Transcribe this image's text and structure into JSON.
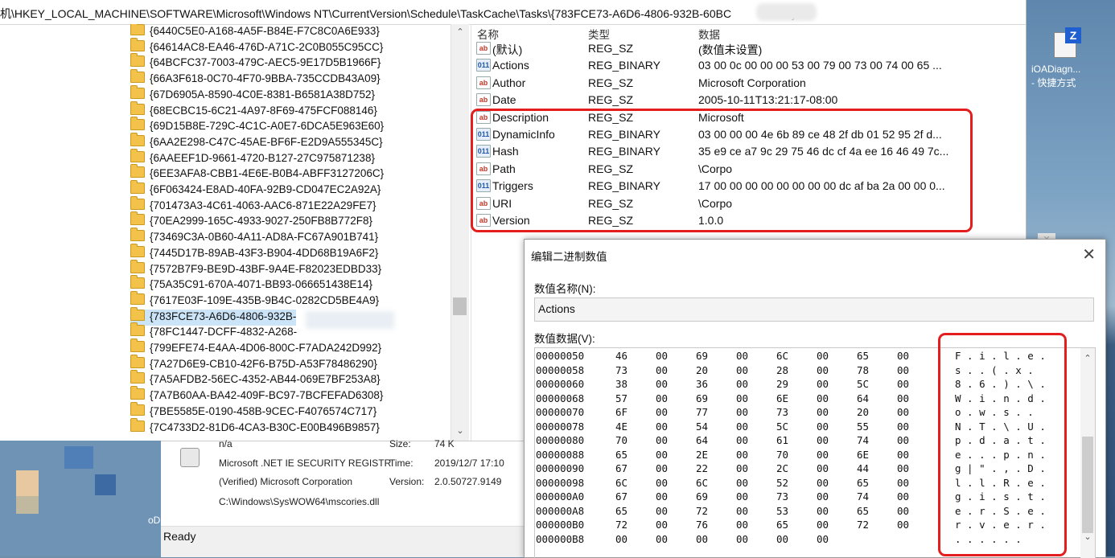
{
  "address_bar": {
    "path": "机\\HKEY_LOCAL_MACHINE\\SOFTWARE\\Microsoft\\Windows NT\\CurrentVersion\\Schedule\\TaskCache\\Tasks\\{783FCE73-A6D6-4806-932B-60BC",
    "path_end": "}"
  },
  "tree": {
    "items": [
      "{6440C5E0-A168-4A5F-B84E-F7C8C0A6E933}",
      "{64614AC8-EA46-476D-A71C-2C0B055C95CC}",
      "{64BCFC37-7003-479C-AEC5-9E17D5B1966F}",
      "{66A3F618-0C70-4F70-9BBA-735CCDB43A09}",
      "{67D6905A-8590-4C0E-8381-B6581A38D752}",
      "{68ECBC15-6C21-4A97-8F69-475FCF088146}",
      "{69D15B8E-729C-4C1C-A0E7-6DCA5E963E60}",
      "{6AA2E298-C47C-45AE-BF6F-E2D9A555345C}",
      "{6AAEEF1D-9661-4720-B127-27C975871238}",
      "{6EE3AFA8-CBB1-4E6E-B0B4-ABFF3127206C}",
      "{6F063424-E8AD-40FA-92B9-CD047EC2A92A}",
      "{701473A3-4C61-4063-AAC6-871E22A29FE7}",
      "{70EA2999-165C-4933-9027-250FB8B772F8}",
      "{73469C3A-0B60-4A11-AD8A-FC67A901B741}",
      "{7445D17B-89AB-43F3-B904-4DD68B19A6F2}",
      "{7572B7F9-BE9D-43BF-9A4E-F82023EDBD33}",
      "{75A35C91-670A-4071-BB93-066651438E14}",
      "{7617E03F-109E-435B-9B4C-0282CD5BE4A9}",
      "{783FCE73-A6D6-4806-932B-",
      "{78FC1447-DCFF-4832-A268-",
      "{799EFE74-E4AA-4D06-800C-F7ADA242D992}",
      "{7A27D6E9-CB10-42F6-B75D-A53F78486290}",
      "{7A5AFDB2-56EC-4352-AB44-069E7BF253A8}",
      "{7A7B60AA-BA42-409F-BC97-7BCFEFAD6308}",
      "{7BE5585E-0190-458B-9CEC-F4076574C717}",
      "{7C4733D2-81D6-4CA3-B30C-E00B496B9857}"
    ],
    "selected_index": 18
  },
  "values": {
    "headers": {
      "name": "名称",
      "type": "类型",
      "data": "数据"
    },
    "rows": [
      {
        "icon": "ab",
        "name": "(默认)",
        "type": "REG_SZ",
        "data": "(数值未设置)"
      },
      {
        "icon": "bin",
        "name": "Actions",
        "type": "REG_BINARY",
        "data": "03 00 0c 00 00 00 53 00 79 00 73 00 74 00 65 ..."
      },
      {
        "icon": "ab",
        "name": "Author",
        "type": "REG_SZ",
        "data": "Microsoft Corporation"
      },
      {
        "icon": "ab",
        "name": "Date",
        "type": "REG_SZ",
        "data": "2005-10-11T13:21:17-08:00"
      },
      {
        "icon": "ab",
        "name": "Description",
        "type": "REG_SZ",
        "data": "Microsoft"
      },
      {
        "icon": "bin",
        "name": "DynamicInfo",
        "type": "REG_BINARY",
        "data": "03 00 00 00 4e 6b 89 ce 48 2f db 01 52 95 2f d..."
      },
      {
        "icon": "bin",
        "name": "Hash",
        "type": "REG_BINARY",
        "data": "35 e9 ce a7 9c 29 75 46 dc cf 4a ee 16 46 49 7c..."
      },
      {
        "icon": "ab",
        "name": "Path",
        "type": "REG_SZ",
        "data": "\\Corpo"
      },
      {
        "icon": "bin",
        "name": "Triggers",
        "type": "REG_BINARY",
        "data": "17 00 00 00 00 00 00 00 00 dc af ba 2a 00 00 0..."
      },
      {
        "icon": "ab",
        "name": "URI",
        "type": "REG_SZ",
        "data": "\\Corpo"
      },
      {
        "icon": "ab",
        "name": "Version",
        "type": "REG_SZ",
        "data": "1.0.0"
      }
    ]
  },
  "info_panel": {
    "line1_left": "n/a",
    "line1_label": "Size:",
    "line1_value": "74 K",
    "product": "Microsoft .NET IE SECURITY REGISTR",
    "time_label": "Time:",
    "time_value": "2019/12/7 17:10",
    "company": "(Verified) Microsoft Corporation",
    "version_label": "Version:",
    "version_value": "2.0.50727.9149",
    "path": "C:\\Windows\\SysWOW64\\mscories.dll"
  },
  "status": {
    "text": "Ready"
  },
  "dialog": {
    "title": "编辑二进制数值",
    "close_glyph": "✕",
    "name_label": "数值名称(N):",
    "name_value": "Actions",
    "data_label": "数值数据(V):",
    "rows": [
      {
        "addr": "00000050",
        "bytes": [
          "46",
          "00",
          "69",
          "00",
          "6C",
          "00",
          "65",
          "00"
        ],
        "ascii": "F . i . l . e ."
      },
      {
        "addr": "00000058",
        "bytes": [
          "73",
          "00",
          "20",
          "00",
          "28",
          "00",
          "78",
          "00"
        ],
        "ascii": "s .   . ( . x ."
      },
      {
        "addr": "00000060",
        "bytes": [
          "38",
          "00",
          "36",
          "00",
          "29",
          "00",
          "5C",
          "00"
        ],
        "ascii": "8 . 6 . ) . \\ ."
      },
      {
        "addr": "00000068",
        "bytes": [
          "57",
          "00",
          "69",
          "00",
          "6E",
          "00",
          "64",
          "00"
        ],
        "ascii": "W . i . n . d ."
      },
      {
        "addr": "00000070",
        "bytes": [
          "6F",
          "00",
          "77",
          "00",
          "73",
          "00",
          "20",
          "00"
        ],
        "ascii": "o . w . s .   ."
      },
      {
        "addr": "00000078",
        "bytes": [
          "4E",
          "00",
          "54",
          "00",
          "5C",
          "00",
          "55",
          "00"
        ],
        "ascii": "N . T . \\ . U ."
      },
      {
        "addr": "00000080",
        "bytes": [
          "70",
          "00",
          "64",
          "00",
          "61",
          "00",
          "74",
          "00"
        ],
        "ascii": "p . d . a . t ."
      },
      {
        "addr": "00000088",
        "bytes": [
          "65",
          "00",
          "2E",
          "00",
          "70",
          "00",
          "6E",
          "00"
        ],
        "ascii": "e . . . p . n ."
      },
      {
        "addr": "00000090",
        "bytes": [
          "67",
          "00",
          "22",
          "00",
          "2C",
          "00",
          "44",
          "00"
        ],
        "ascii": "g | \" . , . D ."
      },
      {
        "addr": "00000098",
        "bytes": [
          "6C",
          "00",
          "6C",
          "00",
          "52",
          "00",
          "65",
          "00"
        ],
        "ascii": "l . l . R . e ."
      },
      {
        "addr": "000000A0",
        "bytes": [
          "67",
          "00",
          "69",
          "00",
          "73",
          "00",
          "74",
          "00"
        ],
        "ascii": "g . i . s . t ."
      },
      {
        "addr": "000000A8",
        "bytes": [
          "65",
          "00",
          "72",
          "00",
          "53",
          "00",
          "65",
          "00"
        ],
        "ascii": "e . r . S . e ."
      },
      {
        "addr": "000000B0",
        "bytes": [
          "72",
          "00",
          "76",
          "00",
          "65",
          "00",
          "72",
          "00"
        ],
        "ascii": "r . v . e . r ."
      },
      {
        "addr": "000000B8",
        "bytes": [
          "00",
          "00",
          "00",
          "00",
          "00",
          "00",
          "",
          ""
        ],
        "ascii": ". . . . . ."
      }
    ]
  },
  "desktop_icon": {
    "label_line1": "iOADiagn...",
    "label_line2": "- 快捷方式",
    "badge": "Z"
  },
  "desktop_partial": "oD",
  "colors": {
    "highlight_box": "#e41e1e",
    "selection": "#cce4f7"
  }
}
